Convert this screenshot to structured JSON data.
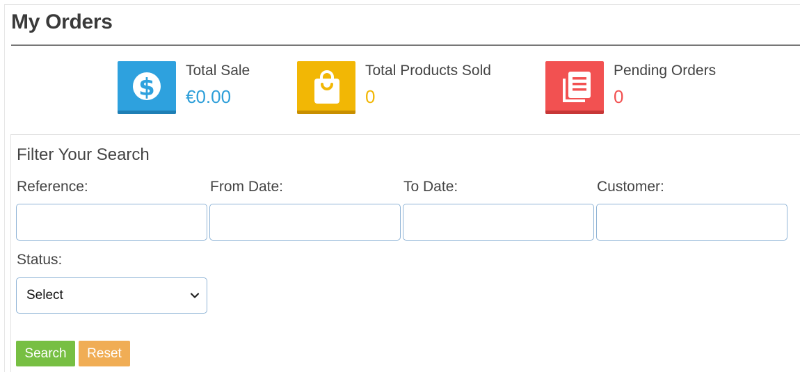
{
  "page": {
    "title": "My Orders"
  },
  "stats": [
    {
      "label": "Total Sale",
      "value": "€0.00",
      "icon": "dollar-icon",
      "tile_color": "#2ea1de",
      "value_color": "#2e9fd9"
    },
    {
      "label": "Total Products Sold",
      "value": "0",
      "icon": "shopping-bag-icon",
      "tile_color": "#f2b705",
      "value_color": "#f2b705"
    },
    {
      "label": "Pending Orders",
      "value": "0",
      "icon": "orders-list-icon",
      "tile_color": "#f25151",
      "value_color": "#f25151"
    }
  ],
  "filter": {
    "title": "Filter Your Search",
    "fields": [
      {
        "label": "Reference:",
        "value": "",
        "placeholder": ""
      },
      {
        "label": "From Date:",
        "value": "",
        "placeholder": ""
      },
      {
        "label": "To Date:",
        "value": "",
        "placeholder": ""
      },
      {
        "label": "Customer:",
        "value": "",
        "placeholder": ""
      }
    ],
    "status": {
      "label": "Status:",
      "selected": "Select"
    },
    "buttons": {
      "search": "Search",
      "reset": "Reset"
    }
  }
}
